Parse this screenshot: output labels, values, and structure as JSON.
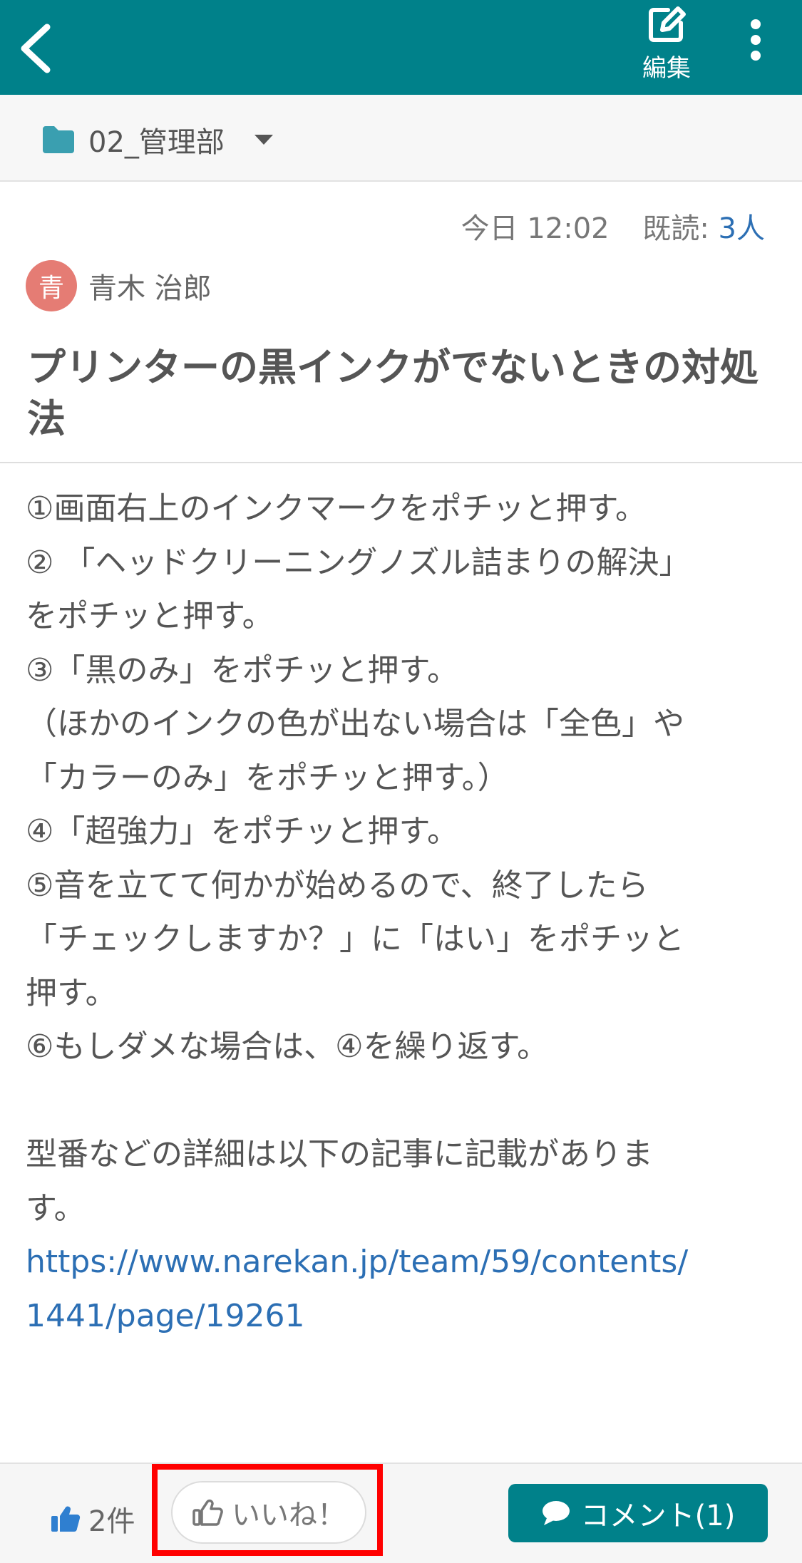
{
  "header": {
    "edit_label": "編集"
  },
  "folder": {
    "name": "02_管理部"
  },
  "meta": {
    "date": "今日 12:02",
    "read_label": "既読:",
    "read_count": "3人"
  },
  "author": {
    "initial": "青",
    "name": "青木 治郎"
  },
  "post": {
    "title": "プリンターの黒インクがでないときの対処法",
    "lines": [
      "①画面右上のインクマークをポチッと押す。",
      "② 「ヘッドクリーニングノズル詰まりの解決」",
      "をポチッと押す。",
      "③「黒のみ」をポチッと押す。",
      "（ほかのインクの色が出ない場合は「全色」や",
      "「カラーのみ」をポチッと押す。）",
      "④「超強力」をポチッと押す。",
      "⑤音を立てて何かが始めるので、終了したら",
      "「チェックしますか？」に「はい」をポチッと",
      "押す。",
      "⑥もしダメな場合は、④を繰り返す。",
      "",
      "型番などの詳細は以下の記事に記載がありま",
      "す。"
    ],
    "link_line1": "https://www.narekan.jp/team/59/contents/",
    "link_line2": "1441/page/19261"
  },
  "footer": {
    "like_count": "2件",
    "like_button": "いいね！",
    "comment_button": "コメント(1)"
  },
  "colors": {
    "header_bg": "#00818a",
    "link": "#2c6fb4",
    "avatar": "#e57c74",
    "highlight": "#ff0000"
  },
  "icons": [
    "back-arrow-icon",
    "edit-icon",
    "more-vertical-icon",
    "folder-icon",
    "caret-down-icon",
    "thumbs-up-icon",
    "thumbs-up-outline-icon",
    "comment-icon"
  ]
}
